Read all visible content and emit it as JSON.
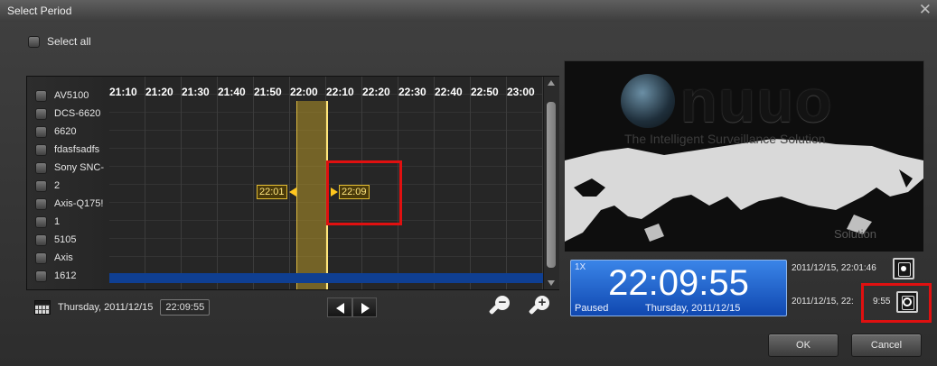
{
  "window": {
    "title": "Select Period",
    "close_glyph": "✕"
  },
  "select_all": {
    "label": "Select all"
  },
  "channels": [
    "AV5100",
    "DCS-6620",
    "6620",
    "fdasfsadfs",
    "Sony SNC-",
    "2",
    "Axis-Q175!",
    "1",
    "5105",
    "Axis",
    "1612"
  ],
  "timeline": {
    "hours": [
      "21:10",
      "21:20",
      "21:30",
      "21:40",
      "21:50",
      "22:00",
      "22:10",
      "22:20",
      "22:30",
      "22:40",
      "22:50",
      "23:00"
    ],
    "start_marker": "22:01",
    "end_marker": "22:09"
  },
  "date_bar": {
    "date": "Thursday, 2011/12/15",
    "time": "22:09:55"
  },
  "preview": {
    "brand": "nuuo",
    "tagline": "The Intelligent Surveillance Solution",
    "faint_caption": "Solution"
  },
  "clock": {
    "speed": "1X",
    "time": "22:09:55",
    "state": "Paused",
    "day": "Thursday, 2011/12/15"
  },
  "bookmarks": {
    "start": "2011/12/15, 22:01:46",
    "end_left": "2011/12/15, 22:",
    "end_right": "9:55"
  },
  "buttons": {
    "ok": "OK",
    "cancel": "Cancel"
  }
}
